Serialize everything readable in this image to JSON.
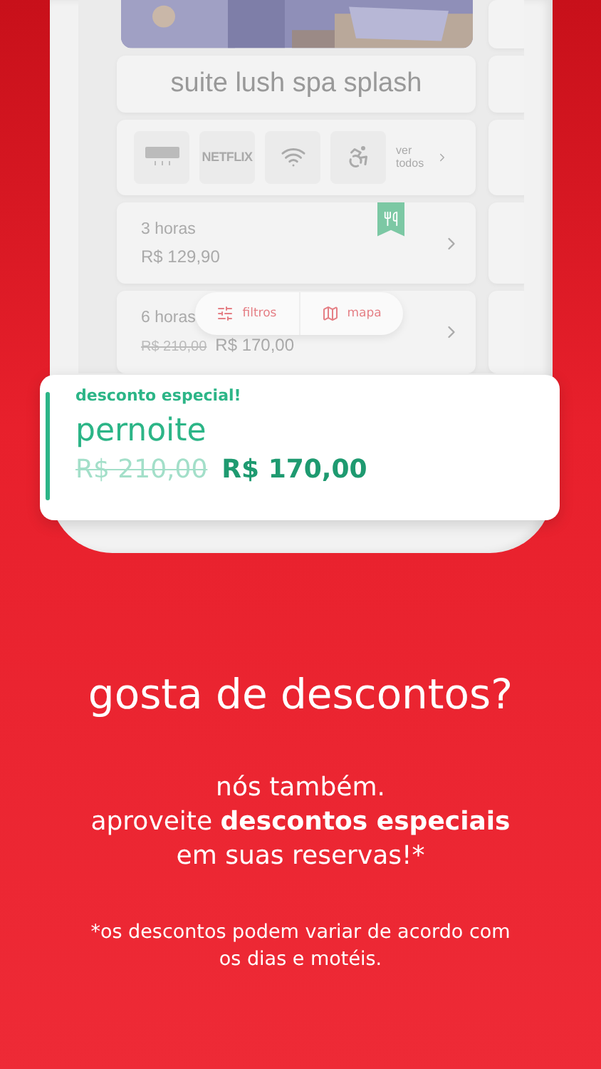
{
  "room": {
    "title": "suite lush spa splash"
  },
  "amenities": [
    {
      "kind": "air"
    },
    {
      "kind": "netflix",
      "label": "NETFLIX"
    },
    {
      "kind": "wifi"
    },
    {
      "kind": "accessible"
    }
  ],
  "see_all": {
    "label": "ver todos"
  },
  "periods": [
    {
      "name": "3 horas",
      "price": "R$ 129,90",
      "food_badge": true
    },
    {
      "name": "6 horas",
      "old_price": "R$ 210,00",
      "price": "R$ 170,00",
      "food_badge": false
    }
  ],
  "float_bar": [
    {
      "kind": "filter",
      "label": "filtros"
    },
    {
      "kind": "map",
      "label": "mapa"
    }
  ],
  "discount_card": {
    "tag": "desconto especial!",
    "name": "pernoite",
    "old_price": "R$ 210,00",
    "price": "R$ 170,00"
  },
  "headline": "gosta de descontos?",
  "body": [
    "nós também.",
    "aproveite **descontos especiais**",
    "em suas reservas!*"
  ],
  "footnote": "*os descontos podem variar de acordo com os dias e motéis."
}
